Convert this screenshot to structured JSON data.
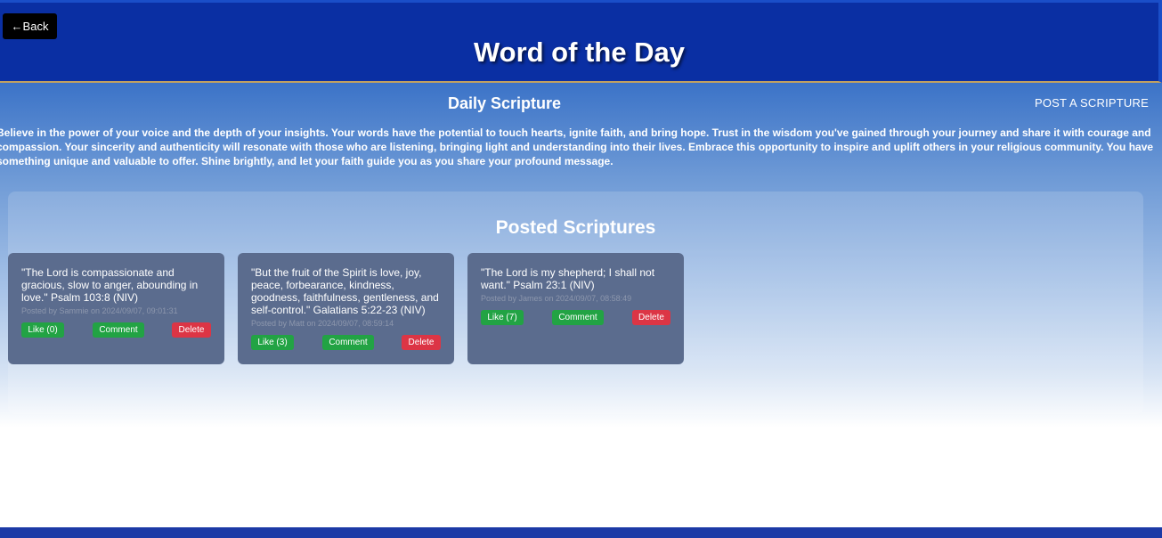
{
  "header": {
    "back_label": "←Back",
    "title": "Word of the Day"
  },
  "daily": {
    "title": "Daily Scripture",
    "post_label": "POST A SCRIPTURE",
    "intro": "Believe in the power of your voice and the depth of your insights. Your words have the potential to touch hearts, ignite faith, and bring hope. Trust in the wisdom you've gained through your journey and share it with courage and compassion. Your sincerity and authenticity will resonate with those who are listening, bringing light and understanding into their lives. Embrace this opportunity to inspire and uplift others in your religious community. You have something unique and valuable to offer. Shine brightly, and let your faith guide you as you share your profound message."
  },
  "posted": {
    "title": "Posted Scriptures",
    "cards": [
      {
        "text": "\"The Lord is compassionate and gracious, slow to anger, abounding in love.\" Psalm 103:8 (NIV)",
        "meta": "Posted by Sammie on 2024/09/07, 09:01:31",
        "like": "Like (0)",
        "comment": "Comment",
        "delete": "Delete"
      },
      {
        "text": "\"But the fruit of the Spirit is love, joy, peace, forbearance, kindness, goodness, faithfulness, gentleness, and self-control.\" Galatians 5:22-23 (NIV)",
        "meta": "Posted by Matt on 2024/09/07, 08:59:14",
        "like": "Like (3)",
        "comment": "Comment",
        "delete": "Delete"
      },
      {
        "text": "\"The Lord is my shepherd; I shall not want.\" Psalm 23:1 (NIV)",
        "meta": "Posted by James on 2024/09/07, 08:58:49",
        "like": "Like (7)",
        "comment": "Comment",
        "delete": "Delete"
      }
    ]
  },
  "colors": {
    "header_bg": "#0a2fa3",
    "card_bg": "#5b6c8e",
    "like_comment": "#22a344",
    "delete": "#dc3545"
  }
}
